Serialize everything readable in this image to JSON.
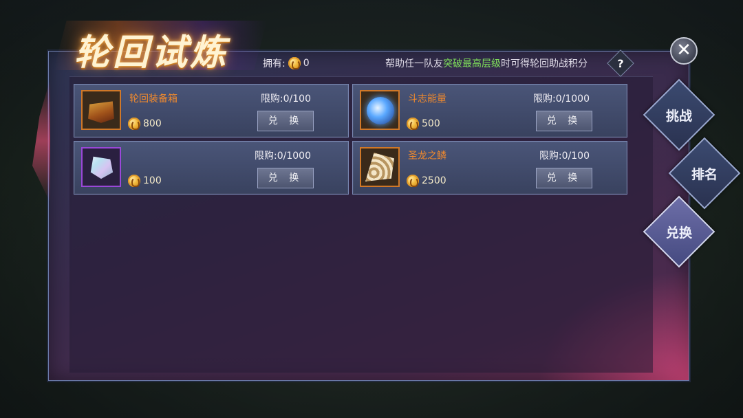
{
  "title": "轮回试炼",
  "owned": {
    "label": "拥有:",
    "value": "0"
  },
  "hint": {
    "prefix": "帮助任一队友",
    "highlight": "突破最高层级",
    "suffix": "时可得轮回助战积分"
  },
  "help_label": "?",
  "close_label": "✕",
  "items": [
    {
      "name": "轮回装备箱",
      "limit": "限购:0/100",
      "price": "800",
      "button": "兑 换",
      "rarity": "orange",
      "icon": "treasure-chest-icon"
    },
    {
      "name": "斗志能量",
      "limit": "限购:0/1000",
      "price": "500",
      "button": "兑 换",
      "rarity": "orange",
      "icon": "energy-orb-icon"
    },
    {
      "name": "",
      "limit": "限购:0/1000",
      "price": "100",
      "button": "兑 换",
      "rarity": "purple",
      "icon": "crystal-icon"
    },
    {
      "name": "圣龙之鳞",
      "limit": "限购:0/100",
      "price": "2500",
      "button": "兑 换",
      "rarity": "orange",
      "icon": "dragon-scale-icon"
    }
  ],
  "tabs": [
    {
      "label": "挑战",
      "active": false
    },
    {
      "label": "排名",
      "active": false
    },
    {
      "label": "兑换",
      "active": true
    }
  ],
  "colors": {
    "orange": "#f28a2c",
    "purple": "#a356e6",
    "highlight": "#7fe05a"
  }
}
